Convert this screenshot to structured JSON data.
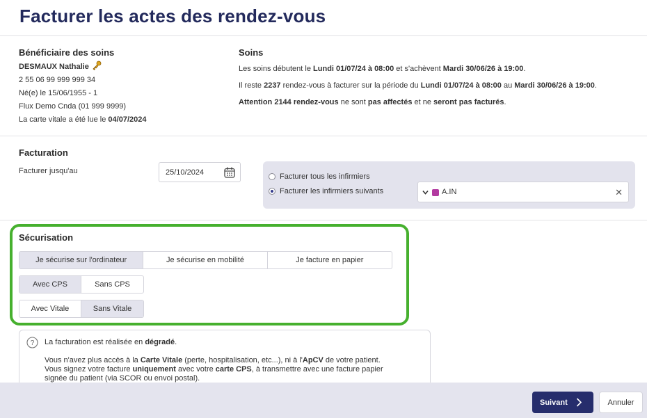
{
  "page_title": "Facturer les actes des rendez-vous",
  "beneficiaire": {
    "title": "Bénéficiaire des soins",
    "name": "DESMAUX Nathalie",
    "nir": "2 55 06 99 999 999 34",
    "birth": "Né(e) le 15/06/1955 - 1",
    "flux": "Flux Demo Cnda (01 999 9999)",
    "carte_prefix": "La carte vitale a été lue le ",
    "carte_date": "04/07/2024"
  },
  "soins": {
    "title": "Soins",
    "l1": [
      "Les soins débutent le ",
      "Lundi 01/07/24 à 08:00",
      " et s'achèvent ",
      "Mardi 30/06/26 à 19:00",
      "."
    ],
    "l2": [
      "Il reste ",
      "2237",
      " rendez-vous à facturer sur la période du ",
      "Lundi 01/07/24 à 08:00",
      " au ",
      "Mardi 30/06/26 à 19:00",
      "."
    ],
    "l3": [
      "Attention 2144 rendez-vous",
      " ne sont ",
      "pas affectés",
      " et ne ",
      "seront pas facturés",
      "."
    ]
  },
  "facturation": {
    "title": "Facturation",
    "label": "Facturer jusqu'au",
    "date_value": "25/10/2024",
    "radio_all": "Facturer tous les infirmiers",
    "radio_some": "Facturer les infirmiers suivants",
    "selected_nurse": "A.IN",
    "nurse_color": "#b23aa0"
  },
  "securisation": {
    "title": "Sécurisation",
    "mode_options": [
      "Je sécurise sur l'ordinateur",
      "Je sécurise en mobilité",
      "Je facture en papier"
    ],
    "cps_options": [
      "Avec CPS",
      "Sans CPS"
    ],
    "vitale_options": [
      "Avec Vitale",
      "Sans Vitale"
    ]
  },
  "info": {
    "head": [
      "La facturation est réalisée en ",
      "dégradé",
      "."
    ],
    "body1": [
      "Vous n'avez plus accès à la ",
      "Carte Vitale",
      " (perte, hospitalisation, etc...), ni à l'",
      "ApCV",
      " de votre patient."
    ],
    "body2": [
      "Vous signez votre facture ",
      "uniquement",
      " avec votre ",
      "carte CPS",
      ", à transmettre avec une facture papier"
    ],
    "body3": "signée du patient (via SCOR ou envoi postal)."
  },
  "footer": {
    "next": "Suivant",
    "cancel": "Annuler"
  },
  "colors": {
    "accent": "#262d6c",
    "highlight_border": "#46b02e"
  }
}
